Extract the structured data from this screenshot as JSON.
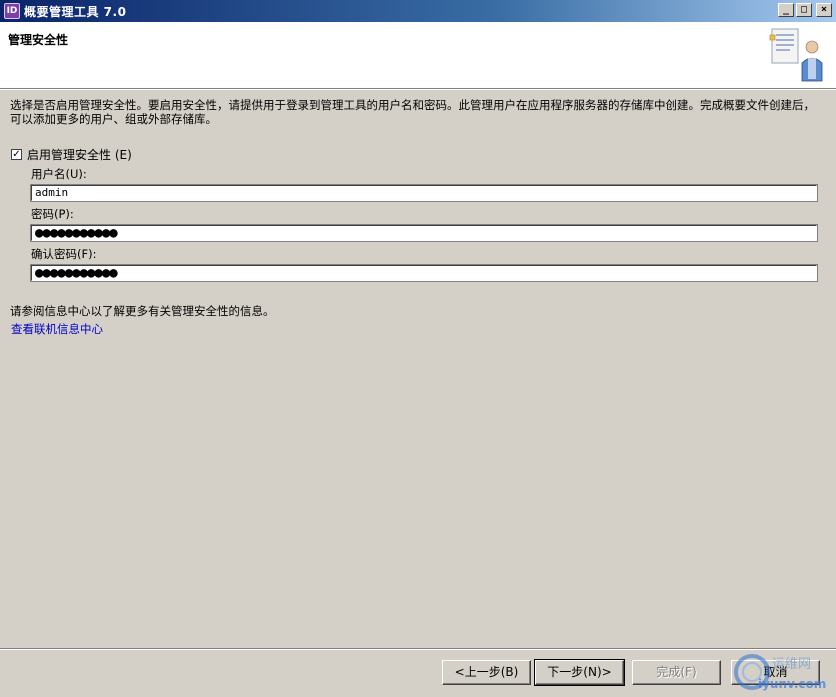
{
  "window": {
    "app_icon_text": "ID",
    "title": "概要管理工具 7.0",
    "minimize": "_",
    "maximize": "□",
    "close": "×"
  },
  "header": {
    "title": "管理安全性"
  },
  "description": "选择是否启用管理安全性。要启用安全性，请提供用于登录到管理工具的用户名和密码。此管理用户在应用程序服务器的存储库中创建。完成概要文件创建后，可以添加更多的用户、组或外部存储库。",
  "security": {
    "enable_checked": true,
    "check_mark": "✓",
    "enable_label": "启用管理安全性 (E)",
    "username_label": "用户名(U):",
    "username_value": "admin",
    "password_label": "密码(P):",
    "password_value": "●●●●●●●●●●●",
    "confirm_label": "确认密码(F):",
    "confirm_value": "●●●●●●●●●●●"
  },
  "info_text": "请参阅信息中心以了解更多有关管理安全性的信息。",
  "info_link": "查看联机信息中心",
  "buttons": {
    "back": "<上一步(B)",
    "next": "下一步(N)>",
    "finish": "完成(F)",
    "cancel": "取消"
  },
  "watermark": {
    "text1": "运维网",
    "text2": "iyunv.com"
  },
  "colors": {
    "title_bar": "#0a246a",
    "link": "#0000cc",
    "dialog_bg": "#d4d0c8"
  }
}
